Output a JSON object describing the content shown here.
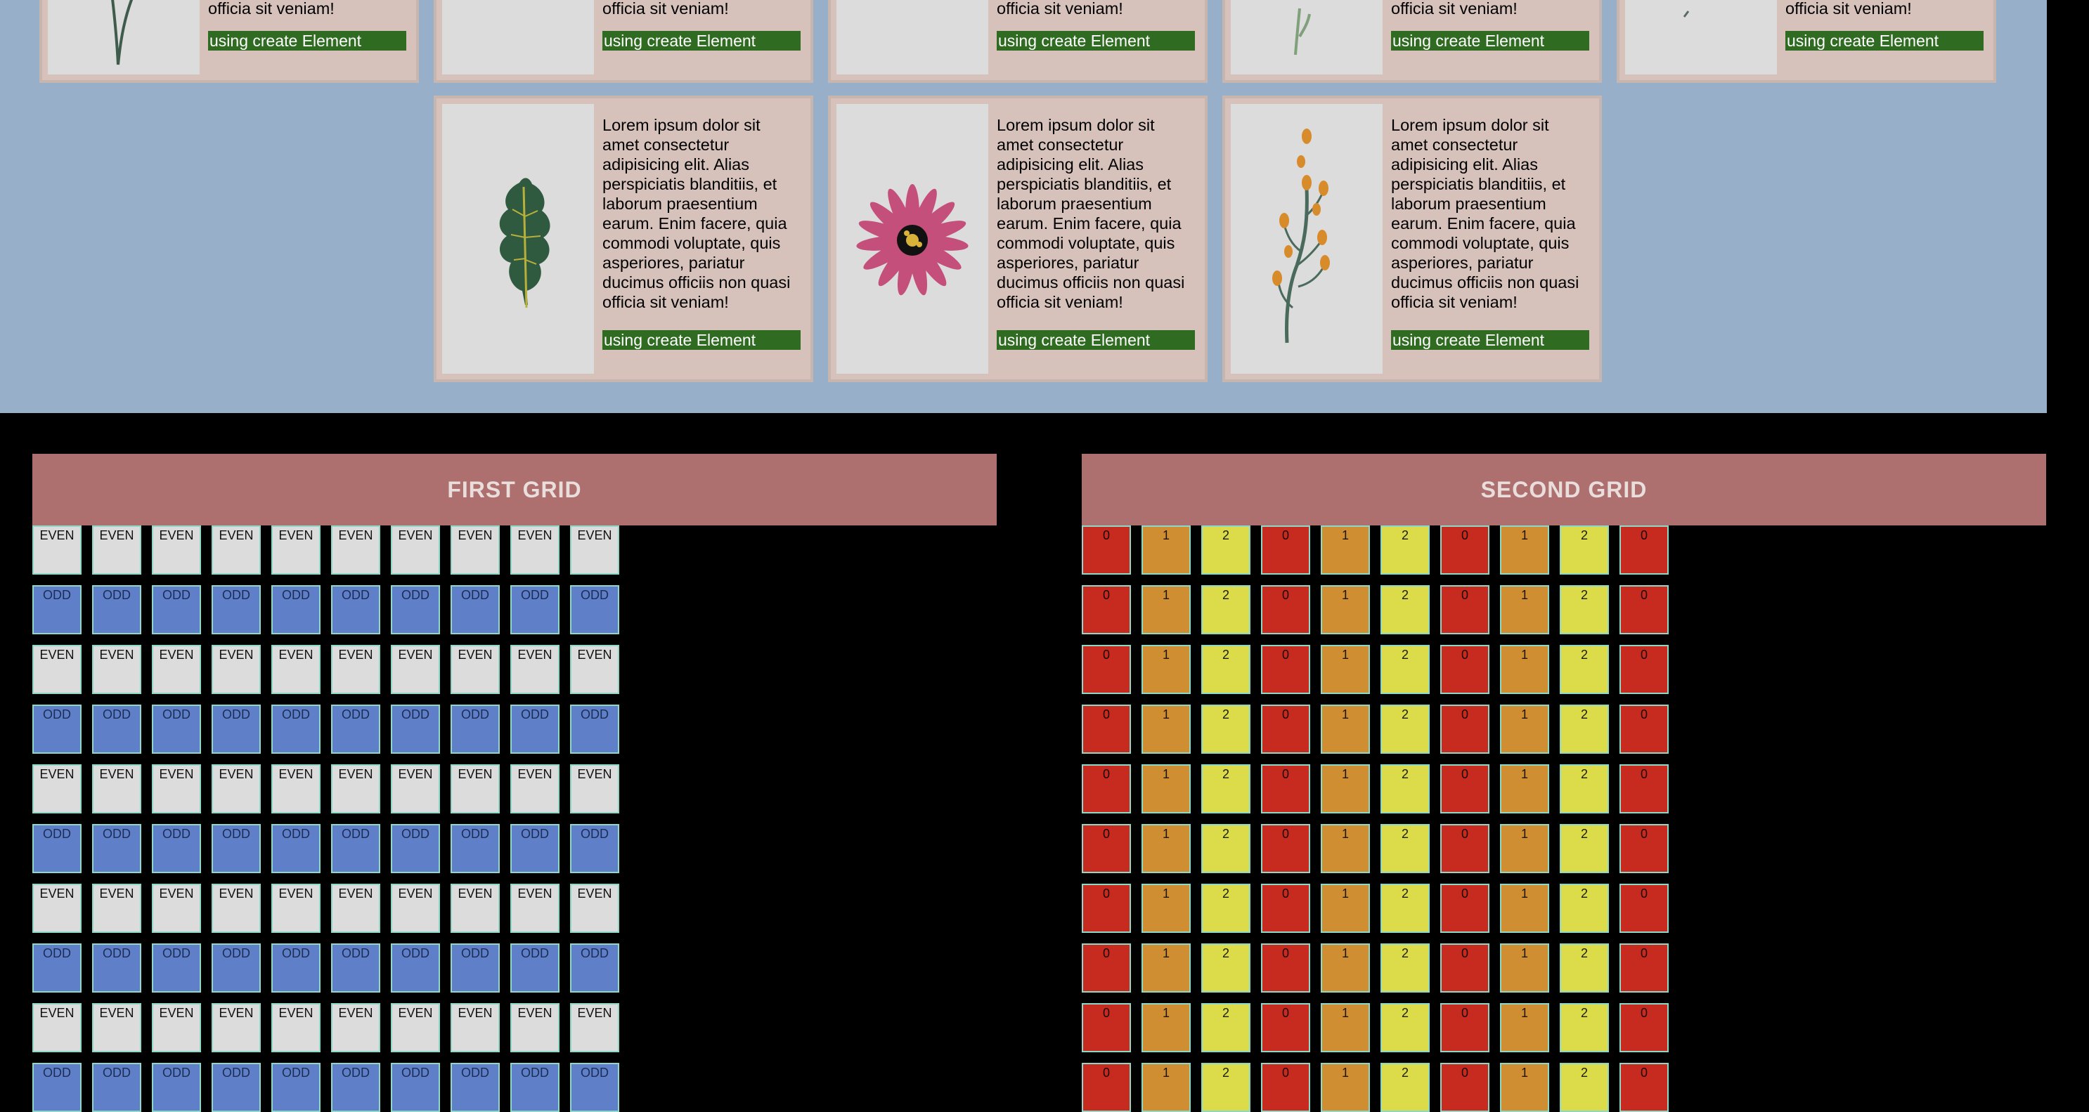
{
  "cards": {
    "body_text": "Lorem ipsum dolor sit amet consectetur adipisicing elit. Alias perspiciatis blanditiis, et laborum praesentium earum. Enim facere, quia commodi voluptate, quis asperiores, pariatur ducimus officiis non quasi officia sit veniam!",
    "truncated_text": "officia sit veniam!",
    "button_label": "using create Element",
    "top_row_images": [
      "grass-blade-image",
      "blank-image",
      "blank-image",
      "sprig-image",
      "blank-image"
    ],
    "bottom_row_images": [
      "oak-leaf-image",
      "pink-flower-image",
      "orange-berry-branch-image"
    ]
  },
  "first_grid": {
    "title": "FIRST GRID",
    "even_label": "EVEN",
    "odd_label": "ODD",
    "rows": 10,
    "cols": 10
  },
  "second_grid": {
    "title": "SECOND GRID",
    "row_values": [
      "0",
      "1",
      "2",
      "0",
      "1",
      "2",
      "0",
      "1",
      "2",
      "0"
    ],
    "rows": 10
  },
  "colors": {
    "page_bg": "#000000",
    "card_section_bg": "#97afc8",
    "card_bg": "#d6c2bb",
    "button_bg": "#2f6b21",
    "header_bg": "#ae6f6f",
    "even_cell": "#dcdcdc",
    "odd_cell": "#5f80c8",
    "mod0": "#c72b20",
    "mod1": "#d08e33",
    "mod2": "#dcdc4a"
  }
}
